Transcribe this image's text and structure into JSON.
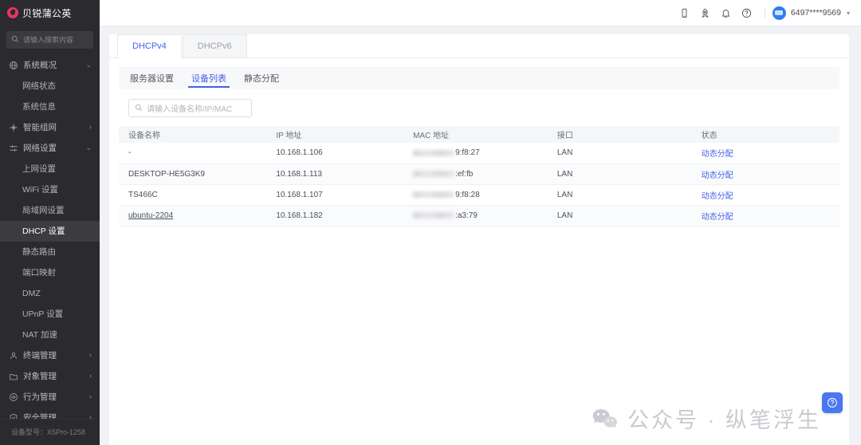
{
  "sidebar": {
    "brand": "贝锐蒲公英",
    "brand_icon": "dandelion-logo-icon",
    "search_placeholder": "请输入搜索内容",
    "search_icon": "search-icon",
    "device_model": "设备型号：X5Pro-1258",
    "nav": [
      {
        "label": "系统概况",
        "icon": "globe-icon",
        "type": "group",
        "expanded": true,
        "chevron": "⌄"
      },
      {
        "label": "网络状态",
        "type": "leaf",
        "active": false
      },
      {
        "label": "系统信息",
        "type": "leaf",
        "active": false
      },
      {
        "label": "智能组网",
        "icon": "network-node-icon",
        "type": "group",
        "expanded": false,
        "chevron": "›"
      },
      {
        "label": "网络设置",
        "icon": "sliders-icon",
        "type": "group",
        "expanded": true,
        "chevron": "⌄"
      },
      {
        "label": "上网设置",
        "type": "leaf",
        "active": false
      },
      {
        "label": "WiFi 设置",
        "type": "leaf",
        "active": false
      },
      {
        "label": "局域网设置",
        "type": "leaf",
        "active": false
      },
      {
        "label": "DHCP 设置",
        "type": "leaf",
        "active": true
      },
      {
        "label": "静态路由",
        "type": "leaf",
        "active": false
      },
      {
        "label": "端口映射",
        "type": "leaf",
        "active": false
      },
      {
        "label": "DMZ",
        "type": "leaf",
        "active": false
      },
      {
        "label": "UPnP 设置",
        "type": "leaf",
        "active": false
      },
      {
        "label": "NAT 加速",
        "type": "leaf",
        "active": false
      },
      {
        "label": "终端管理",
        "icon": "users-icon",
        "type": "group",
        "expanded": false,
        "chevron": "›"
      },
      {
        "label": "对象管理",
        "icon": "folder-icon",
        "type": "group",
        "expanded": false,
        "chevron": "›"
      },
      {
        "label": "行为管理",
        "icon": "eye-circle-icon",
        "type": "group",
        "expanded": false,
        "chevron": "›"
      },
      {
        "label": "安全管理",
        "icon": "shield-check-icon",
        "type": "group",
        "expanded": false,
        "chevron": "›"
      }
    ]
  },
  "topbar": {
    "icons": [
      "mobile-icon",
      "rocket-icon",
      "bell-icon",
      "help-circle-icon"
    ],
    "account": "6497****9569",
    "account_caret": "▾"
  },
  "tabs": [
    {
      "label": "DHCPv4",
      "active": true
    },
    {
      "label": "DHCPv6",
      "active": false
    }
  ],
  "subtabs": [
    {
      "label": "服务器设置",
      "active": false
    },
    {
      "label": "设备列表",
      "active": true
    },
    {
      "label": "静态分配",
      "active": false
    }
  ],
  "search": {
    "placeholder": "请输入设备名称/IP/MAC",
    "value": "",
    "icon": "search-icon"
  },
  "table": {
    "columns": [
      "设备名称",
      "IP 地址",
      "MAC 地址",
      "接口",
      "状态"
    ],
    "rows": [
      {
        "name": "-",
        "name_link": false,
        "ip": "10.168.1.106",
        "mac_suffix": "9:f8:27",
        "iface": "LAN",
        "status": "动态分配"
      },
      {
        "name": "DESKTOP-HE5G3K9",
        "name_link": false,
        "ip": "10.168.1.113",
        "mac_suffix": ":ef:fb",
        "iface": "LAN",
        "status": "动态分配"
      },
      {
        "name": "TS466C",
        "name_link": false,
        "ip": "10.168.1.107",
        "mac_suffix": "9:f8:28",
        "iface": "LAN",
        "status": "动态分配"
      },
      {
        "name": "ubuntu-2204",
        "name_link": true,
        "ip": "10.168.1.182",
        "mac_suffix": ":a3:79",
        "iface": "LAN",
        "status": "动态分配"
      }
    ]
  },
  "watermark": {
    "text": "公众号 · 纵笔浮生",
    "icon": "wechat-icon"
  },
  "help_fab": {
    "icon": "question-circle-icon",
    "glyph": "?"
  },
  "colors": {
    "accent": "#4461e8",
    "sidebar_bg": "#2b2b2f",
    "sidebar_active": "#3b3b40",
    "brand": "#e8355f",
    "fab": "#4a77f0"
  }
}
